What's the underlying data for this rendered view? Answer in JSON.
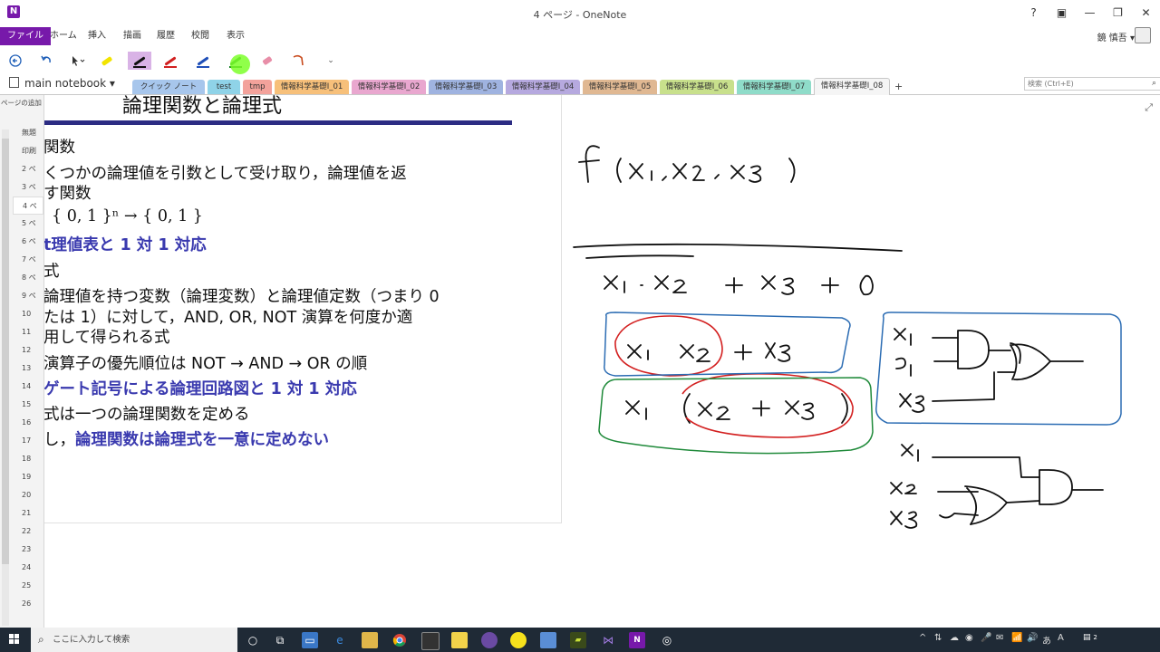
{
  "window": {
    "title": "4 ページ - OneNote",
    "logo": "N",
    "help": "?",
    "controls": [
      "▣",
      "—",
      "❐",
      "✕"
    ]
  },
  "ribbon": {
    "tabs": [
      "ファイル",
      "ホーム",
      "挿入",
      "描画",
      "履歴",
      "校閲",
      "表示"
    ],
    "active_tab": "描画",
    "user_name": "鏡 慎吾 ▾"
  },
  "toolbar": {
    "tools": [
      {
        "icon": "back-arrow-icon"
      },
      {
        "icon": "undo-icon"
      },
      {
        "icon": "lasso-select-icon"
      },
      {
        "icon": "highlighter-yellow-icon",
        "color": "#f2e400"
      },
      {
        "icon": "pen-black-icon",
        "color": "#111111",
        "active": true
      },
      {
        "icon": "pen-red-icon",
        "color": "#d12020"
      },
      {
        "icon": "pen-blue-icon",
        "color": "#1f4fb8"
      },
      {
        "icon": "pen-green-icon",
        "color": "#0a7a1a"
      },
      {
        "icon": "eraser-icon",
        "color": "#e88ea8"
      },
      {
        "icon": "lasso-icon",
        "color": "#c84a1c"
      }
    ]
  },
  "notebook": {
    "name": "main notebook ▾",
    "sections": [
      {
        "label": "クイック ノート",
        "color": "#a7c6ec"
      },
      {
        "label": "test",
        "color": "#8fd3e8"
      },
      {
        "label": "tmp",
        "color": "#f3a29b"
      },
      {
        "label": "情報科学基礎I_01",
        "color": "#f7c07a"
      },
      {
        "label": "情報科学基礎I_02",
        "color": "#e9a7cf"
      },
      {
        "label": "情報科学基礎I_03",
        "color": "#9fb3e0"
      },
      {
        "label": "情報科学基礎I_04",
        "color": "#b6a9df"
      },
      {
        "label": "情報科学基礎I_05",
        "color": "#e0b892"
      },
      {
        "label": "情報科学基礎I_06",
        "color": "#c8e08c"
      },
      {
        "label": "情報科学基礎I_07",
        "color": "#8fdcc9"
      },
      {
        "label": "情報科学基礎I_08",
        "color": "#f5f5f5",
        "active": true
      }
    ],
    "add_section": "+",
    "search_placeholder": "検索 (Ctrl+E)"
  },
  "pages": {
    "add_label": "ページの追加",
    "items": [
      "無題",
      "印刷",
      "2 ペ",
      "3 ペ",
      "4 ペ",
      "5 ペ",
      "6 ペ",
      "7 ペ",
      "8 ペ",
      "9 ペ",
      "10",
      "11",
      "12",
      "13",
      "14",
      "15",
      "16",
      "17",
      "18",
      "19",
      "20",
      "21",
      "22",
      "23",
      "24",
      "25",
      "26"
    ],
    "selected_index": 4
  },
  "slide": {
    "title": "論理関数と論理式",
    "lines": [
      "関数",
      "くつかの論理値を引数として受け取り，論理値を返",
      "す関数",
      "{ 0, 1 }ⁿ → { 0, 1 }",
      "t理値表と 1 対 1 対応",
      "式",
      "論理値を持つ変数（論理変数）と論理値定数（つまり 0",
      "たは 1）に対して，AND, OR, NOT 演算を何度か適",
      "用して得られる式",
      "演算子の優先順位は NOT → AND → OR の順",
      "ゲート記号による論理回路図と 1 対 1 対応",
      "式は一つの論理関数を定める",
      "し，",
      "論理関数は論理式を一意に定めない"
    ]
  },
  "taskbar": {
    "search_placeholder": "ここに入力して検索",
    "apps": [
      "task-view-icon",
      "explorer-icon",
      "edge-icon",
      "folder-icon",
      "chrome-icon",
      "terminal-icon",
      "notes-icon",
      "eclipse-icon",
      "circle-app-icon",
      "window-app-icon",
      "camtasia-icon",
      "visual-studio-icon",
      "onenote-icon",
      "obs-icon"
    ],
    "tray": [
      "^",
      "⇅",
      "☁",
      "◉",
      "🎤",
      "✉",
      "📶",
      "🔊",
      "あ",
      "A"
    ],
    "clock_badge": "2"
  }
}
